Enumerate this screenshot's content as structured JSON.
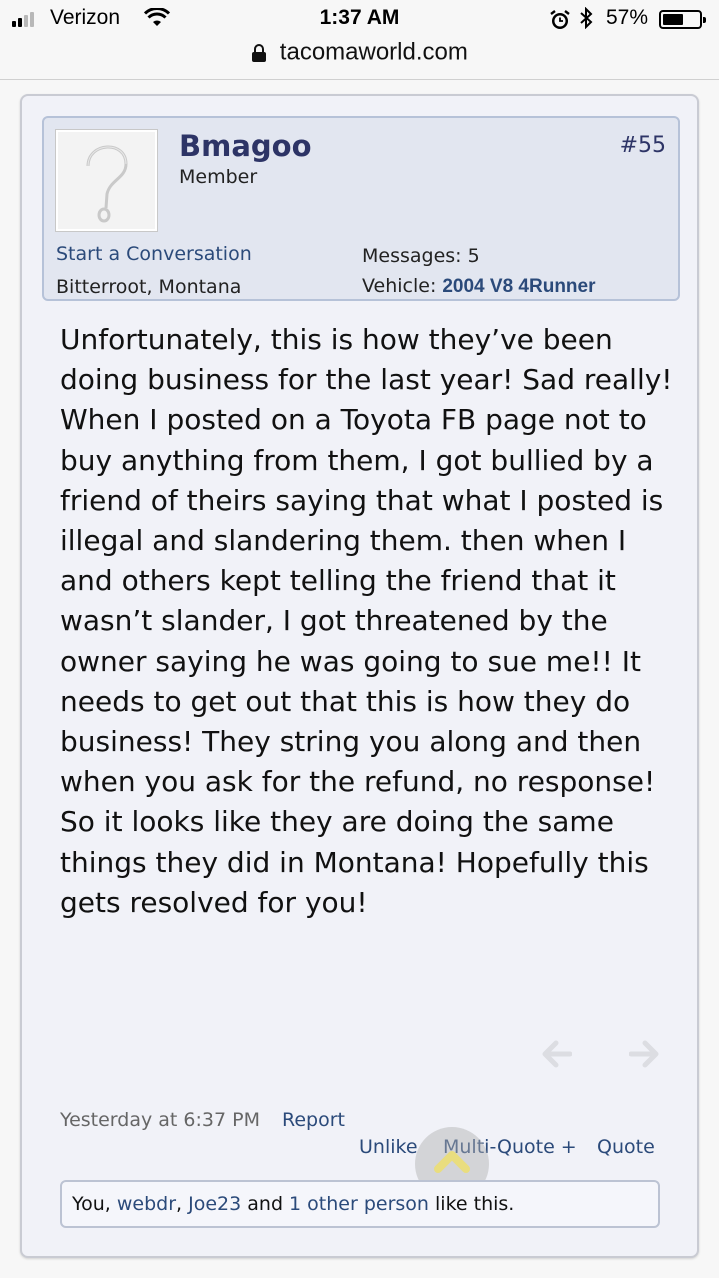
{
  "status_bar": {
    "carrier": "Verizon",
    "time": "1:37 AM",
    "battery": "57%",
    "battery_level": 0.57,
    "icons": [
      "signal-icon",
      "wifi-icon",
      "alarm-icon",
      "bluetooth-icon",
      "battery-icon"
    ]
  },
  "browser": {
    "url": "tacomaworld.com",
    "icon": "lock-icon"
  },
  "post": {
    "username": "Bmagoo",
    "user_title": "Member",
    "post_number": "#55",
    "start_conversation": "Start a Conversation",
    "location": "Bitterroot, Montana",
    "messages_label": "Messages:",
    "messages_value": "5",
    "vehicle_label": "Vehicle:",
    "vehicle_value": "2004 V8 4Runner",
    "body": "Unfortunately, this is how they’ve been doing business for the last year! Sad really! When I posted on a Toyota FB page not to buy anything from them, I got bullied by a friend of theirs saying that what I posted is illegal and slandering them. then when I and others kept telling the friend that it wasn’t slander, I got threatened by the owner saying he was going to sue me!! It needs to get out that this is how they do business! They string you along and then when you ask for the refund, no response! So it looks like they are doing the same things they did in Montana! Hopefully this gets resolved for you!",
    "date": "Yesterday at 6:37 PM",
    "report": "Report",
    "unlike": "Unlike",
    "multi_quote": "Multi-Quote +",
    "quote": "Quote",
    "likes": {
      "you": "You",
      "sep1": ", ",
      "user1": "webdr",
      "sep2": ", ",
      "user2": "Joe23",
      "and": " and ",
      "others": "1 other person",
      "suffix": " like this."
    },
    "icons": [
      "avatar-placeholder-icon",
      "arrow-left-icon",
      "arrow-right-icon",
      "chevron-up-icon"
    ]
  }
}
